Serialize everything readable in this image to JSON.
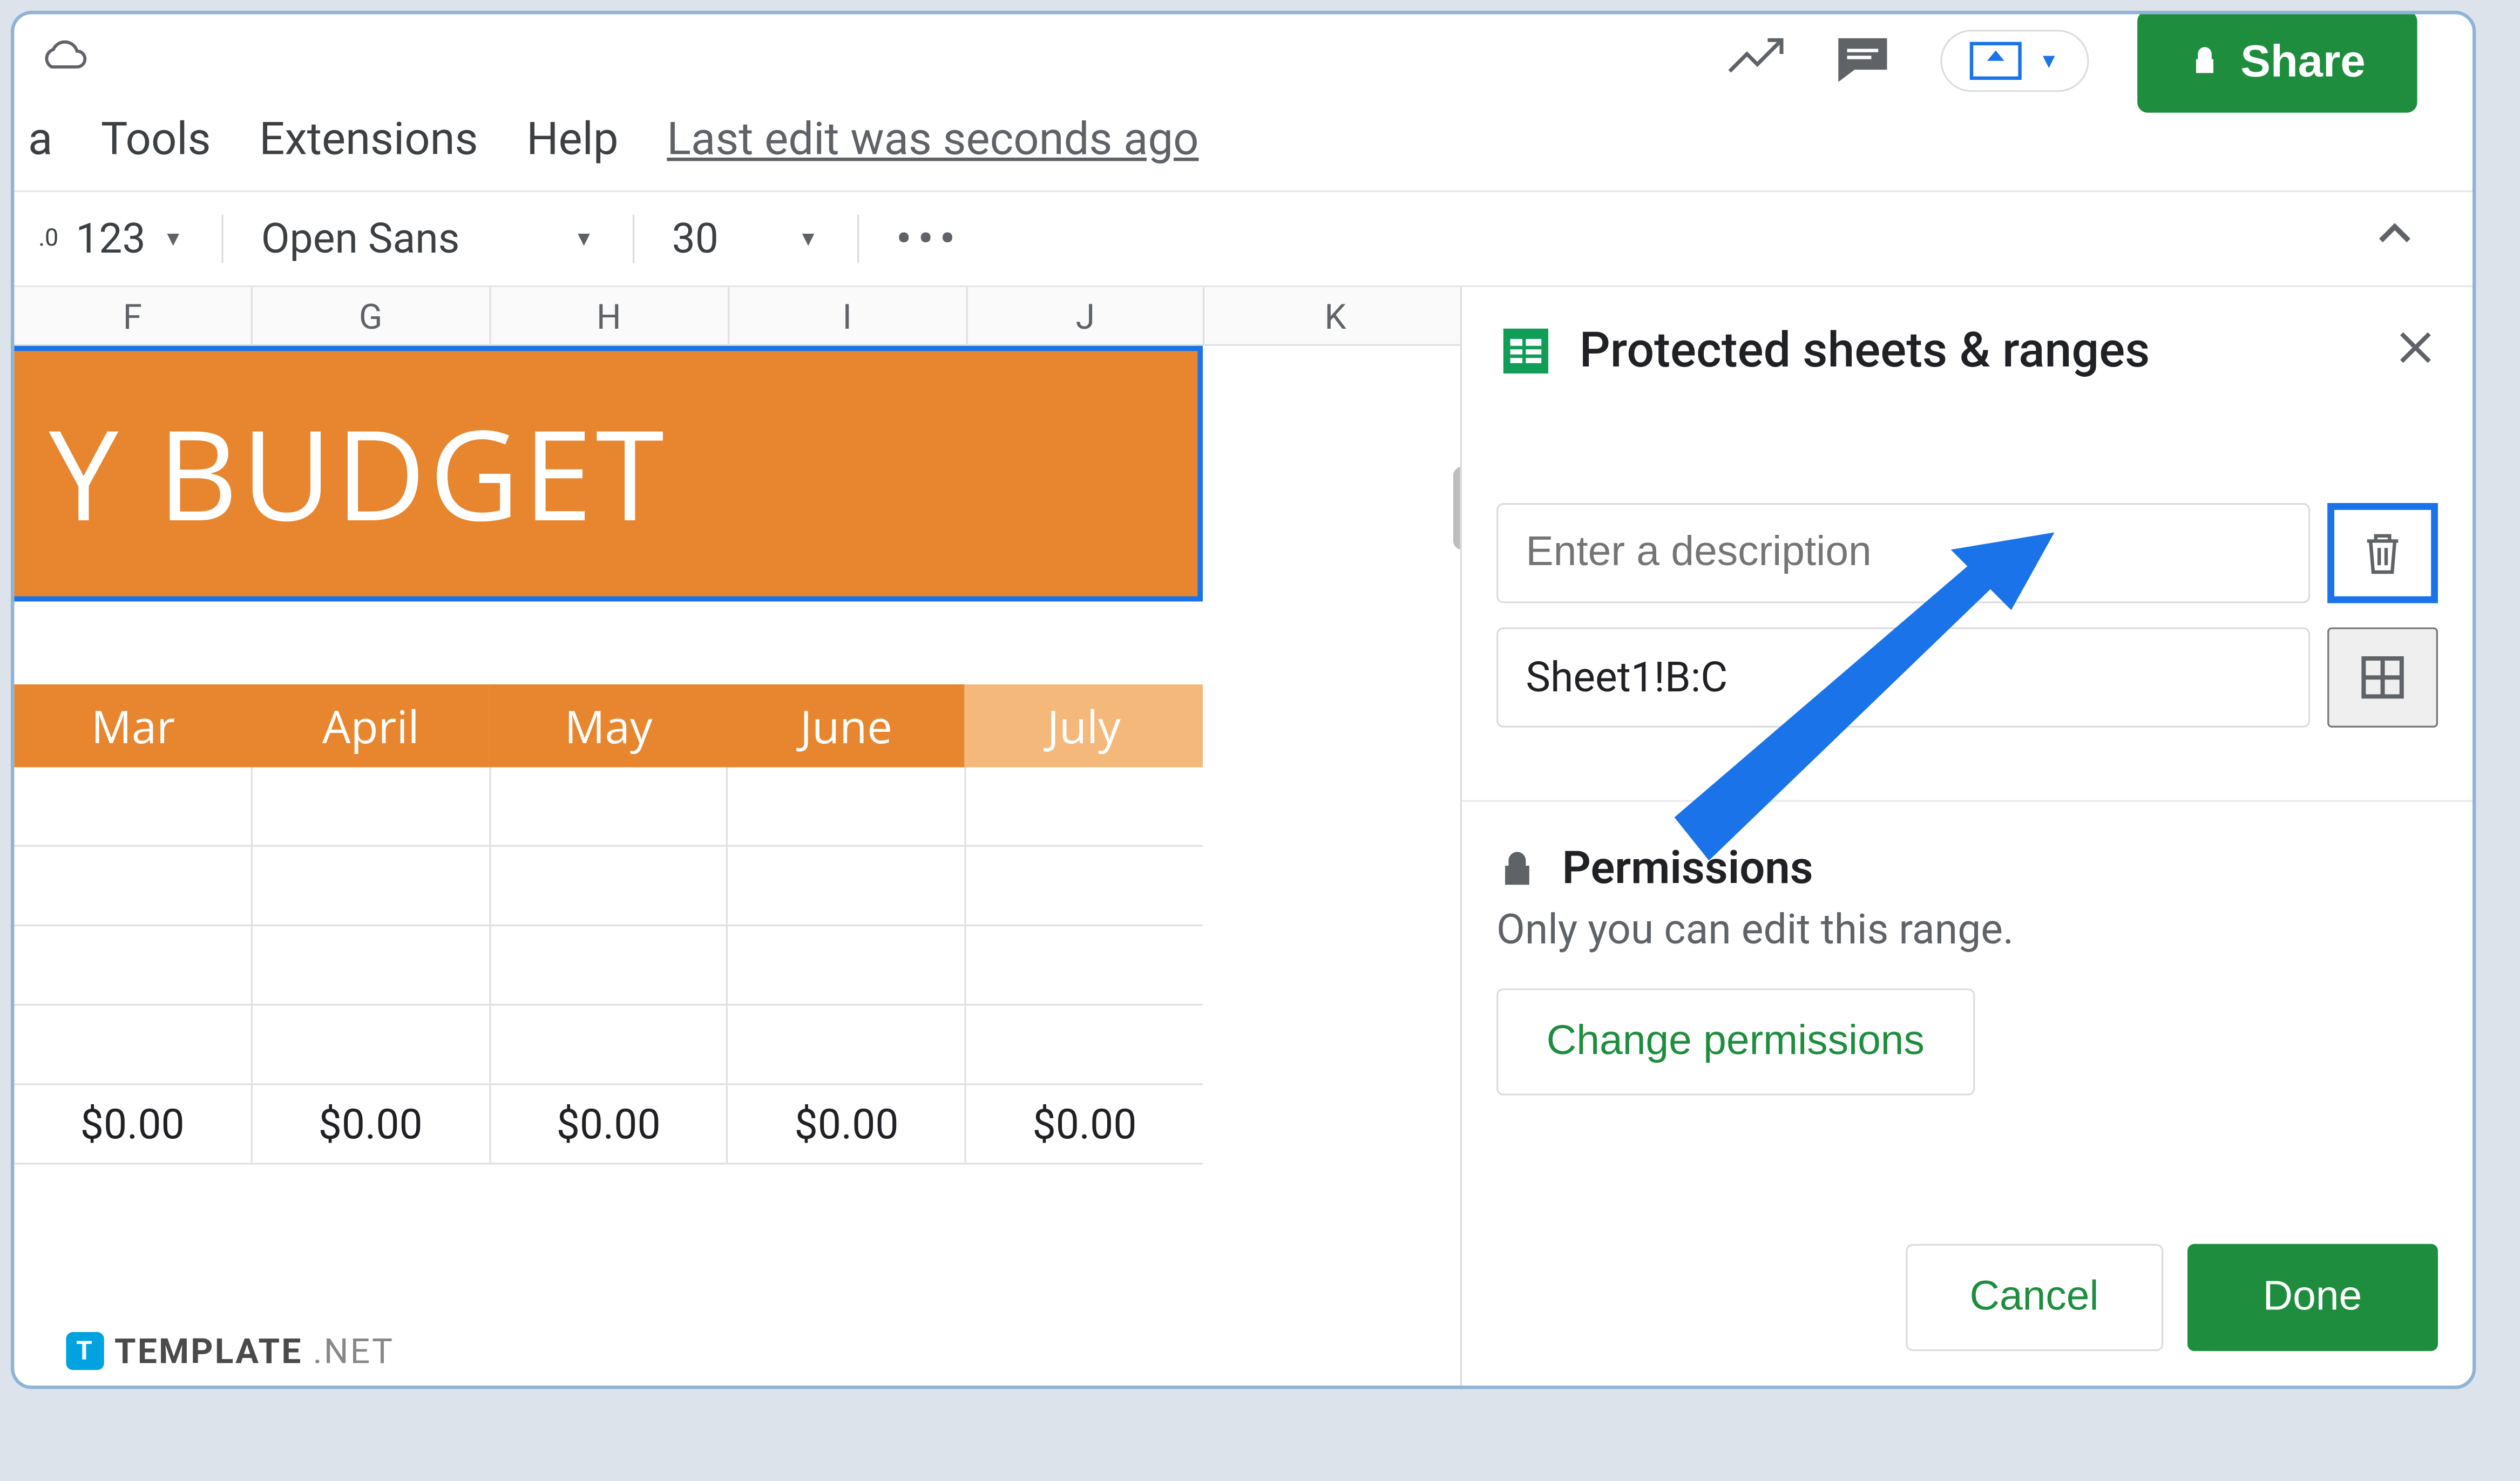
{
  "header": {
    "menus": [
      "a",
      "Tools",
      "Extensions",
      "Help"
    ],
    "last_edit": "Last edit was seconds ago",
    "share_label": "Share"
  },
  "toolbar": {
    "number_format_prefix": ".0",
    "number_format": "123",
    "font": "Open Sans",
    "font_size": "30"
  },
  "sheet": {
    "columns": [
      "F",
      "G",
      "H",
      "I",
      "J",
      "K"
    ],
    "banner_text_fragment": "Y  BUDGET",
    "months": [
      "Mar",
      "April",
      "May",
      "June",
      "July"
    ],
    "totals": [
      "$0.00",
      "$0.00",
      "$0.00",
      "$0.00",
      "$0.00"
    ]
  },
  "panel": {
    "title": "Protected sheets & ranges",
    "description_placeholder": "Enter a description",
    "range_value": "Sheet1!B:C",
    "permissions_title": "Permissions",
    "permissions_sub": "Only you can edit this range.",
    "change_perm_label": "Change permissions",
    "cancel_label": "Cancel",
    "done_label": "Done"
  },
  "watermark": {
    "brand": "TEMPLATE",
    "tld": ".NET"
  },
  "colors": {
    "accent_green": "#1e8e3e",
    "accent_blue": "#1a73e8",
    "banner_orange": "#e8862f"
  }
}
